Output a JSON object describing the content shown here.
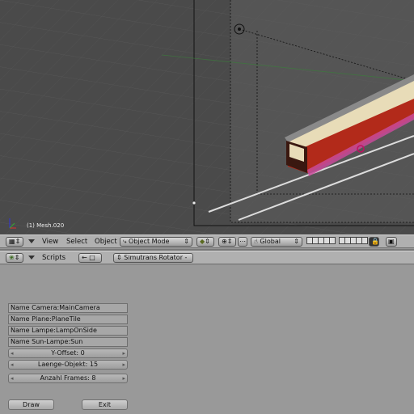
{
  "viewport": {
    "object_info": "(1) Mesh.020"
  },
  "header3d": {
    "menus": [
      "View",
      "Select",
      "Object"
    ],
    "mode_label": "Object Mode",
    "orientation_label": "Global"
  },
  "script_header": {
    "menu_label": "Scripts",
    "script_name": "Simutrans Rotator -"
  },
  "panel": {
    "fields": [
      "Name Camera:MainCamera",
      "Name Plane:PlaneTile",
      "Name Lampe:LampOnSide",
      "Name Sun-Lampe:Sun"
    ],
    "y_offset": "Y-Offset: 0",
    "laenge": "Laenge-Objekt: 15",
    "frames": "Anzahl Frames: 8",
    "draw_label": "Draw",
    "exit_label": "Exit"
  },
  "colors": {
    "viewport_bg": "#4b4b4b",
    "panel_bg": "#999999",
    "header_bg": "#b0b0b0",
    "train_red": "#b22a1a",
    "train_cream": "#e8dcb8"
  }
}
